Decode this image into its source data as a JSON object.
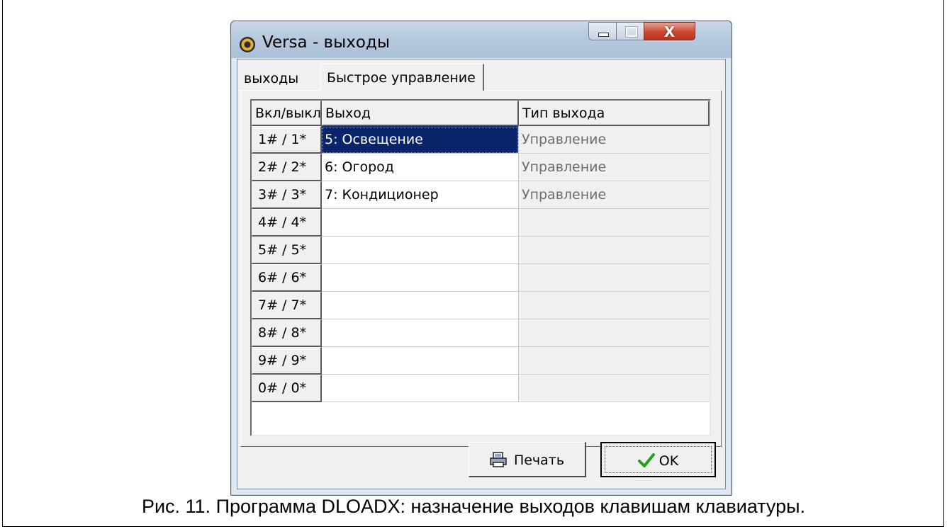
{
  "window": {
    "title": "Versa - выходы"
  },
  "tabs": [
    {
      "label": "выходы",
      "active": false
    },
    {
      "label": "Быстрое управление",
      "active": true
    }
  ],
  "grid": {
    "columns": [
      "Вкл/выкл",
      "Выход",
      "Тип выхода"
    ],
    "rows": [
      {
        "key": "1# / 1*",
        "output": "5: Освещение",
        "type": "Управление",
        "selected": true
      },
      {
        "key": "2# / 2*",
        "output": "6: Огород",
        "type": "Управление"
      },
      {
        "key": "3# / 3*",
        "output": "7: Кондиционер",
        "type": "Управление"
      },
      {
        "key": "4# / 4*",
        "output": "",
        "type": ""
      },
      {
        "key": "5# / 5*",
        "output": "",
        "type": ""
      },
      {
        "key": "6# / 6*",
        "output": "",
        "type": ""
      },
      {
        "key": "7# / 7*",
        "output": "",
        "type": ""
      },
      {
        "key": "8# / 8*",
        "output": "",
        "type": ""
      },
      {
        "key": "9# / 9*",
        "output": "",
        "type": ""
      },
      {
        "key": "0# / 0*",
        "output": "",
        "type": ""
      }
    ]
  },
  "buttons": {
    "print": "Печать",
    "ok": "OK"
  },
  "icons": {
    "app": "dloadx-app-icon",
    "print": "printer-icon",
    "ok": "checkmark-icon"
  },
  "colors": {
    "selection": "#0a246a",
    "close_button": "#c9482f",
    "check": "#1fa21f"
  },
  "caption": "Рис. 11. Программа DLOADX: назначение выходов клавишам клавиатуры."
}
